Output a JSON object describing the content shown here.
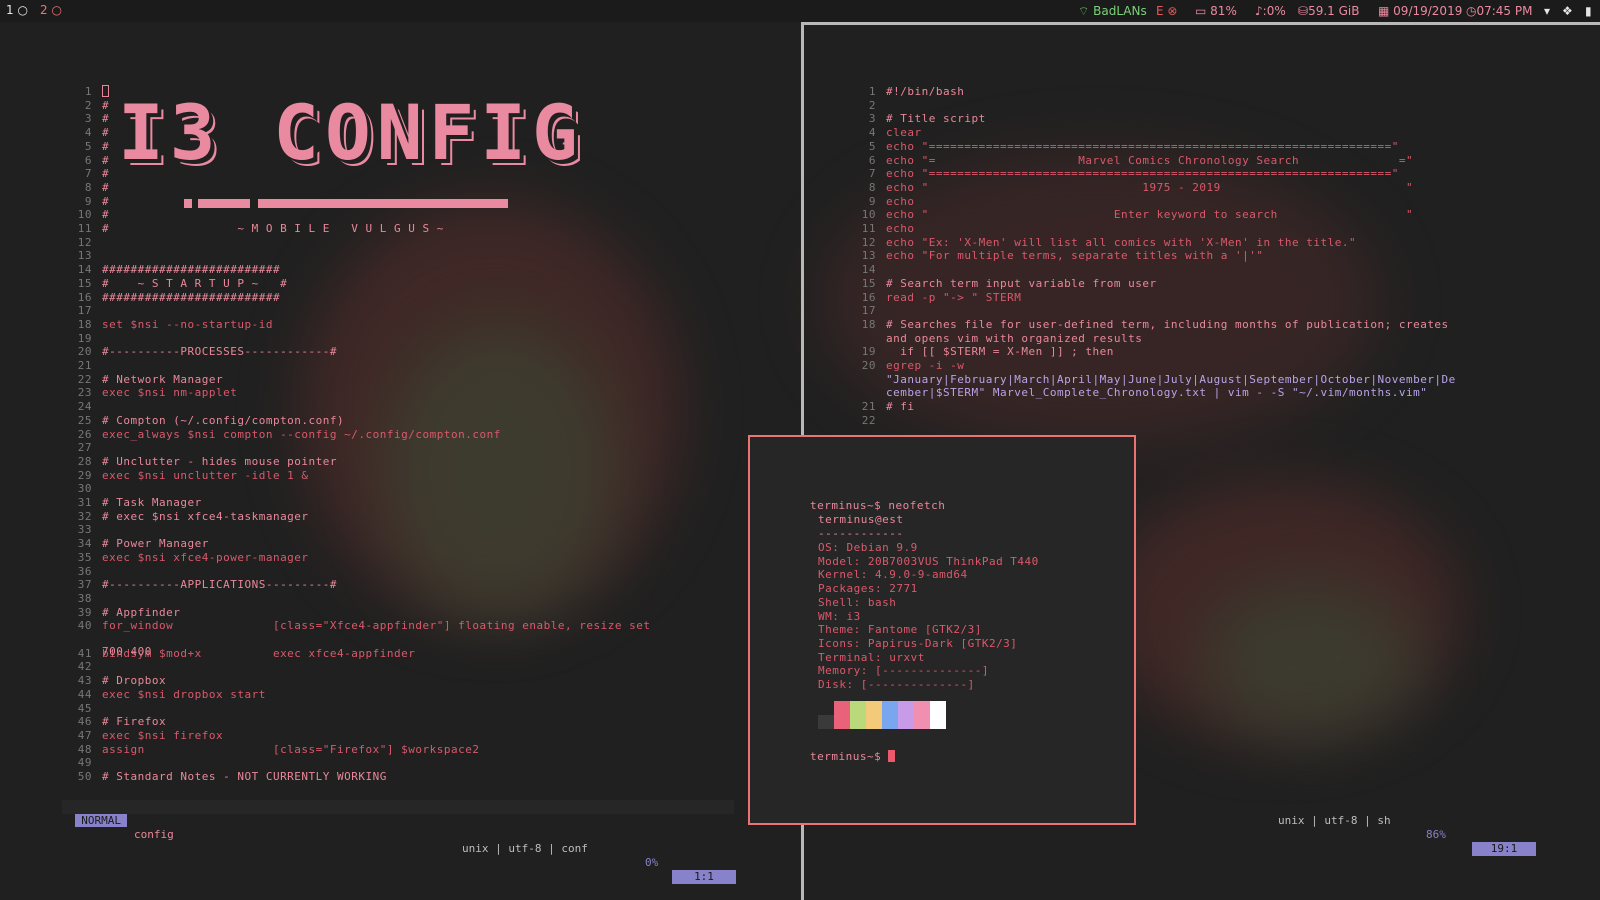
{
  "topbar": {
    "workspaces": [
      {
        "num": "1",
        "icon": "circle-icon"
      },
      {
        "num": "2",
        "icon": "circle-icon"
      }
    ],
    "network": "BadLANs",
    "ethernet": "E",
    "battery": "81%",
    "volume": "0%",
    "disk": "59.1 GiB",
    "date": "09/19/2019",
    "time": "07:45 PM"
  },
  "left": {
    "title": "I3 CONFIG",
    "subtitle": "~ M O B I L E   V U L G U S ~",
    "lines": [
      "#",
      "#",
      "#",
      "#",
      "#",
      "#",
      "#",
      "#",
      "#",
      "#",
      "#                  ~ M O B I L E   V U L G U S ~",
      "",
      "",
      "#########################",
      "#    ~ S T A R T U P ~   #",
      "#########################",
      "",
      "set $nsi --no-startup-id",
      "",
      "#----------PROCESSES------------#",
      "",
      "# Network Manager",
      "exec $nsi nm-applet",
      "",
      "# Compton (~/.config/compton.conf)",
      "exec_always $nsi compton --config ~/.config/compton.conf",
      "",
      "# Unclutter - hides mouse pointer",
      "exec $nsi unclutter -idle 1 &",
      "",
      "# Task Manager",
      "# exec $nsi xfce4-taskmanager",
      "",
      "# Power Manager",
      "exec $nsi xfce4-power-manager",
      "",
      "#----------APPLICATIONS---------#",
      "",
      "# Appfinder",
      "for_window              [class=\"Xfce4-appfinder\"] floating enable, resize set",
      "bindsym $mod+x          exec xfce4-appfinder",
      "",
      "# Dropbox",
      "exec $nsi dropbox start",
      "",
      "# Firefox",
      "exec $nsi firefox",
      "assign                  [class=\"Firefox\"] $workspace2",
      "",
      "# Standard Notes - NOT CURRENTLY WORKING"
    ],
    "line40_wrap": "700 400",
    "status": {
      "mode": "NORMAL",
      "file": "config",
      "info": "unix | utf-8 | conf",
      "percent": "0%",
      "pos": "1:1"
    }
  },
  "right": {
    "lines": [
      {
        "n": "1",
        "t": "#!/bin/bash"
      },
      {
        "n": "2",
        "t": ""
      },
      {
        "n": "3",
        "t": "# Title script"
      },
      {
        "n": "4",
        "t": "clear"
      },
      {
        "n": "5",
        "t": "echo \"=================================================================\""
      },
      {
        "n": "6",
        "t": "echo \"=                    Marvel Comics Chronology Search              =\""
      },
      {
        "n": "7",
        "t": "echo \"=================================================================\""
      },
      {
        "n": "8",
        "t": "echo \"                              1975 - 2019                          \""
      },
      {
        "n": "9",
        "t": "echo"
      },
      {
        "n": "10",
        "t": "echo \"                          Enter keyword to search                  \""
      },
      {
        "n": "11",
        "t": "echo"
      },
      {
        "n": "12",
        "t": "echo \"Ex: 'X-Men' will list all comics with 'X-Men' in the title.\""
      },
      {
        "n": "13",
        "t": "echo \"For multiple terms, separate titles with a '|'\""
      },
      {
        "n": "14",
        "t": ""
      },
      {
        "n": "15",
        "t": "# Search term input variable from user"
      },
      {
        "n": "16",
        "t": "read -p \"-> \" STERM"
      },
      {
        "n": "17",
        "t": ""
      },
      {
        "n": "18",
        "t": "# Searches file for user-defined term, including months of publication; creates"
      },
      {
        "n": "",
        "t": "and opens vim with organized results"
      },
      {
        "n": "19",
        "t": "  if [[ $STERM = X-Men ]] ; then"
      },
      {
        "n": "20",
        "t": "egrep -i -w"
      },
      {
        "n": "",
        "t": "\"January|February|March|April|May|June|July|August|September|October|November|De"
      },
      {
        "n": "",
        "t": "cember|$STERM\" Marvel_Complete_Chronology.txt | vim - -S \"~/.vim/months.vim\""
      },
      {
        "n": "21",
        "t": "# fi"
      },
      {
        "n": "22",
        "t": ""
      }
    ],
    "status": {
      "info": "unix | utf-8 | sh",
      "percent": "86%",
      "pos": "19:1"
    }
  },
  "terminal": {
    "prompt": "terminus~$ neofetch",
    "host": "terminus@est",
    "sep": "------------",
    "info": [
      "OS: Debian 9.9",
      "Model: 20B7003VUS ThinkPad T440",
      "Kernel: 4.9.0-9-amd64",
      "Packages: 2771",
      "Shell: bash",
      "WM: i3",
      "Theme: Fantome [GTK2/3]",
      "Icons: Papirus-Dark [GTK2/3]",
      "Terminal: urxvt",
      "Memory: [--------------]",
      "Disk: [--------------]"
    ],
    "prompt2": "terminus~$",
    "colors": [
      "#3a3a3a",
      "#e9627a",
      "#b9d97a",
      "#f3c97a",
      "#7aa6f0",
      "#c79be8",
      "#f08fb0",
      "#ffffff"
    ]
  }
}
